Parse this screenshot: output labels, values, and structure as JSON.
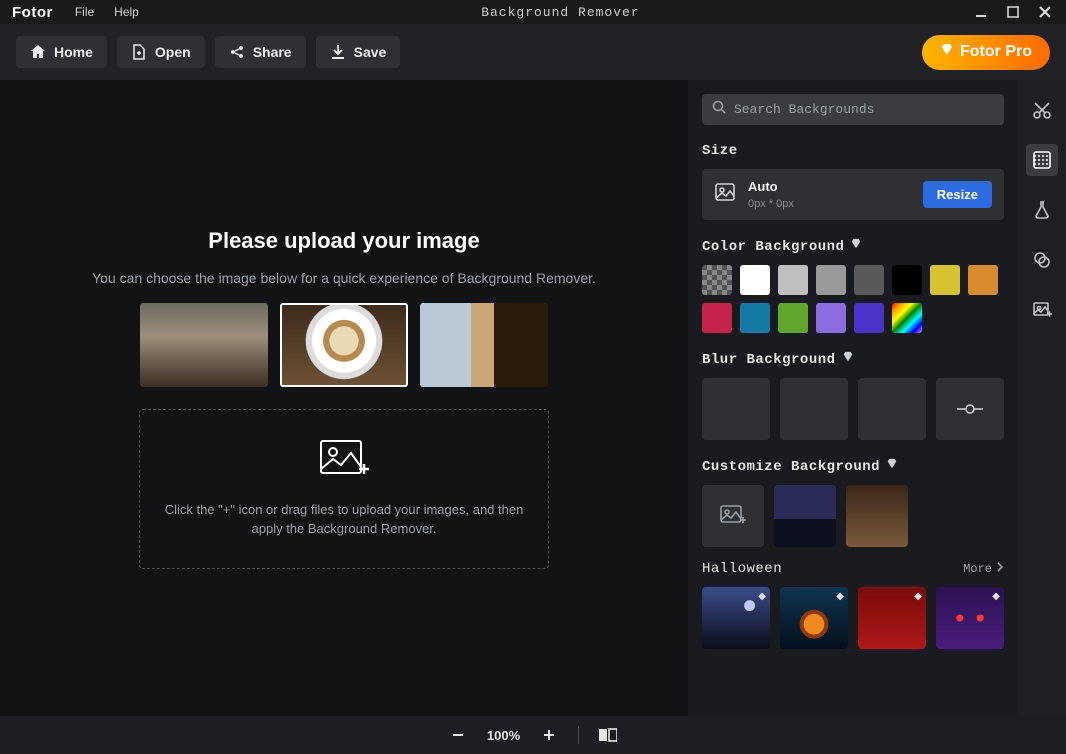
{
  "app": {
    "name": "Fotor",
    "title": "Background Remover"
  },
  "menu": {
    "file": "File",
    "help": "Help"
  },
  "toolbar": {
    "home": "Home",
    "open": "Open",
    "share": "Share",
    "save": "Save",
    "pro": "Fotor Pro"
  },
  "canvas": {
    "heading": "Please upload your image",
    "sub": "You can choose the image below for a quick experience of Background Remover.",
    "drop": "Click the \"+\" icon or drag files to upload your images, and then apply the Background Remover.",
    "samples": [
      "person-portrait",
      "latte-coffee",
      "dog-pug"
    ]
  },
  "panel": {
    "search_placeholder": "Search Backgrounds",
    "size_label": "Size",
    "size_auto": "Auto",
    "size_dim": "0px * 0px",
    "resize": "Resize",
    "color_bg_label": "Color Background",
    "colors": [
      "transparent",
      "#ffffff",
      "#bfbfbf",
      "#9a9a9a",
      "#595959",
      "#000000",
      "#d6c331",
      "#d88a2e",
      "#c42449",
      "#147aa6",
      "#5fa62b",
      "#8a6be0",
      "#4a33c9",
      "rainbow"
    ],
    "blur_label": "Blur Background",
    "customize_label": "Customize Background",
    "halloween_label": "Halloween",
    "more": "More"
  },
  "rail": {
    "tools": [
      "cut-icon",
      "background-icon",
      "flask-icon",
      "overlap-icon",
      "image-plus-icon"
    ],
    "active_index": 1
  },
  "bottom": {
    "zoom": "100%"
  }
}
